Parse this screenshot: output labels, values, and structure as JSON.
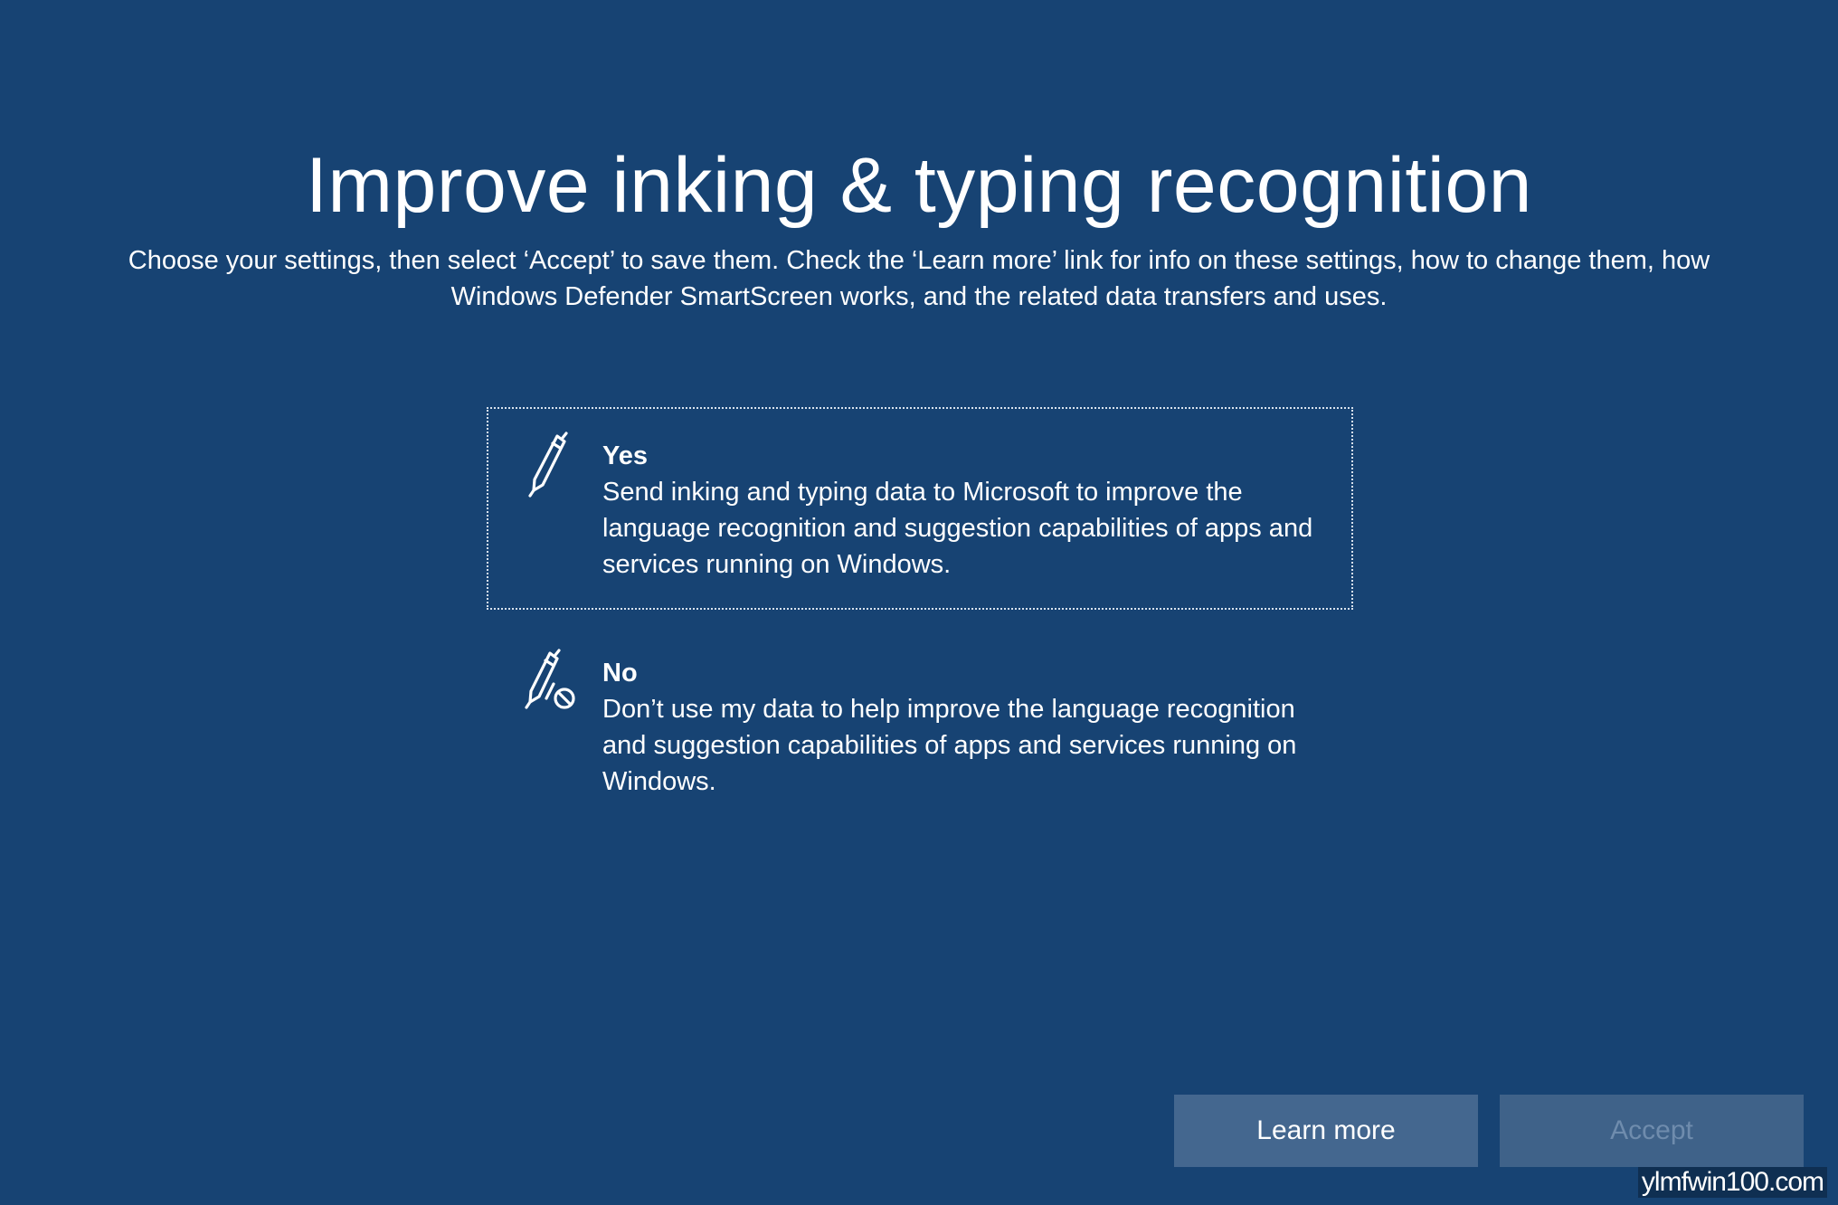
{
  "header": {
    "title": "Improve inking & typing recognition",
    "subtitle": "Choose your settings, then select ‘Accept’ to save them. Check the ‘Learn more’ link for info on these settings, how to change them, how Windows Defender SmartScreen works, and the related data transfers and uses."
  },
  "options": [
    {
      "label": "Yes",
      "description": "Send inking and typing data to Microsoft to improve the language recognition and suggestion capabilities of apps and services running on Windows.",
      "icon": "pen-icon",
      "selected": true
    },
    {
      "label": "No",
      "description": "Don’t use my data to help improve the language recognition and suggestion capabilities of apps and services running on Windows.",
      "icon": "pen-blocked-icon",
      "selected": false
    }
  ],
  "footer": {
    "learn_more_label": "Learn more",
    "accept_label": "Accept"
  },
  "watermark": "ylmfwin100.com",
  "colors": {
    "background": "#174373",
    "button": "#44678f",
    "button_disabled_text": "#6f8cad"
  }
}
